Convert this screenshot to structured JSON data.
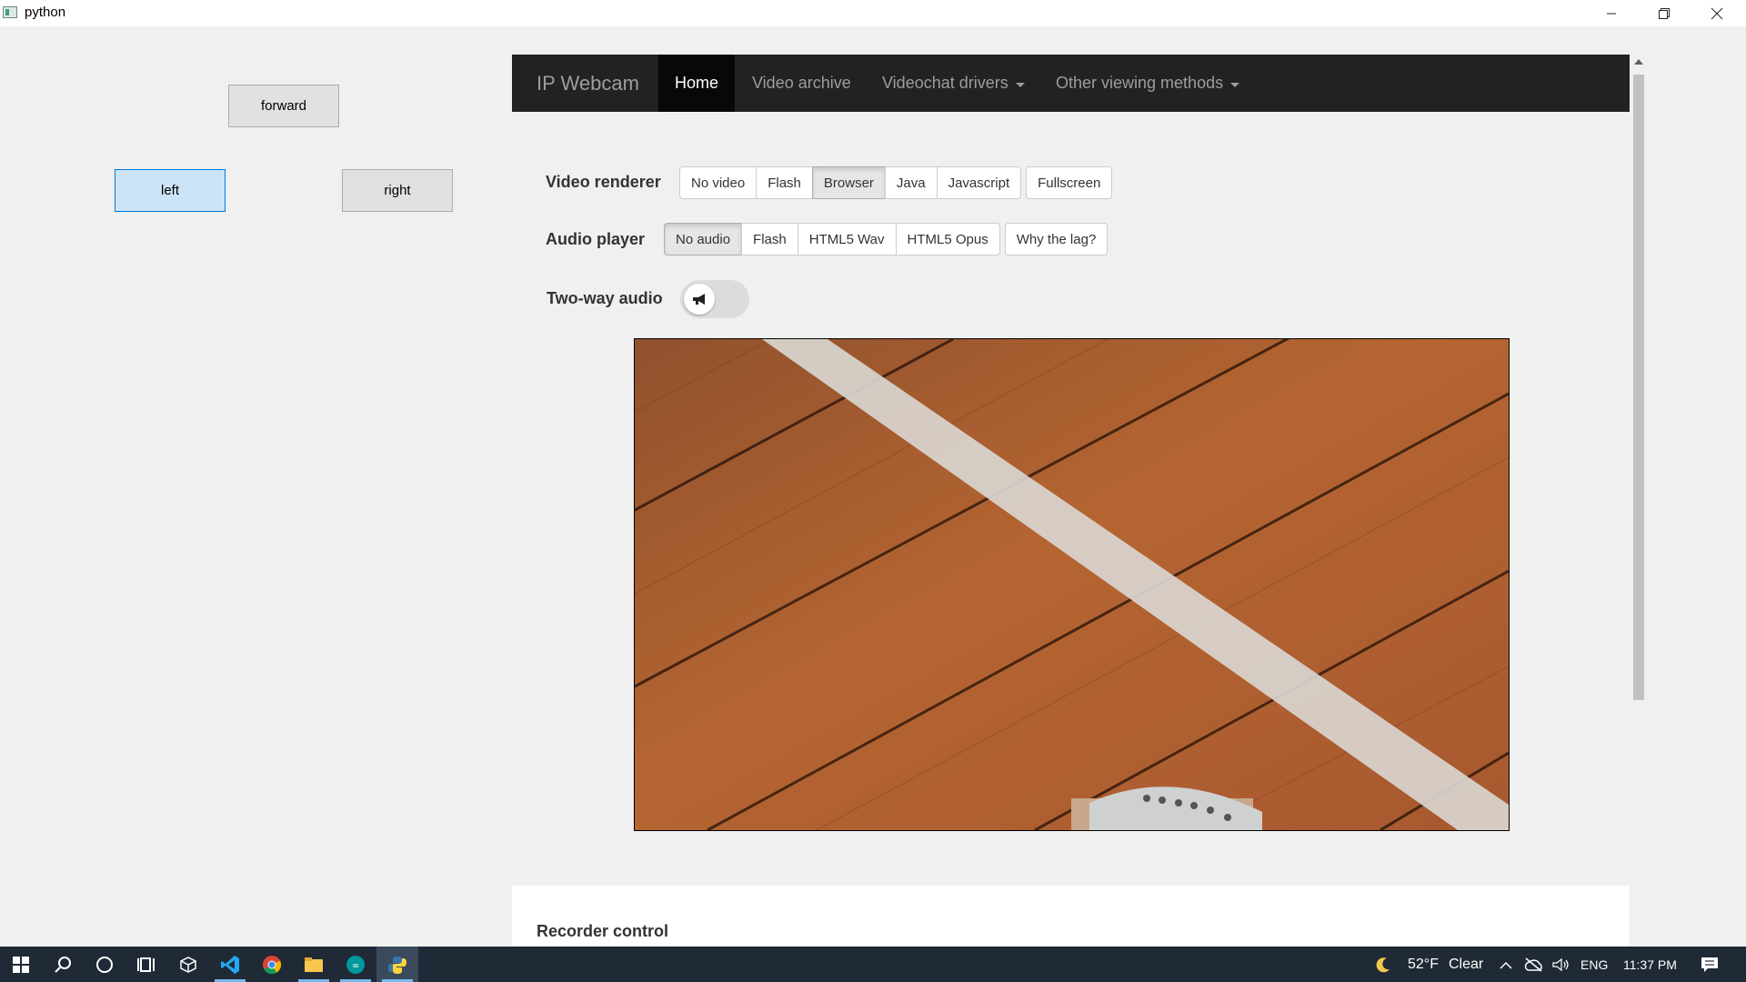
{
  "window": {
    "title": "python",
    "controls": {
      "minimize": "—",
      "restore": "❒",
      "close": "✕"
    }
  },
  "controls_panel": {
    "forward": "forward",
    "left": "left",
    "right": "right"
  },
  "webview": {
    "brand": "IP Webcam",
    "nav": {
      "home": "Home",
      "video_archive": "Video archive",
      "videochat_drivers": "Videochat drivers",
      "other_viewing": "Other viewing methods"
    },
    "video_renderer": {
      "label": "Video renderer",
      "options": [
        "No video",
        "Flash",
        "Browser",
        "Java",
        "Javascript"
      ],
      "selected": "Browser",
      "fullscreen": "Fullscreen"
    },
    "audio_player": {
      "label": "Audio player",
      "options": [
        "No audio",
        "Flash",
        "HTML5 Wav",
        "HTML5 Opus"
      ],
      "selected": "No audio",
      "why_lag": "Why the lag?"
    },
    "two_way_audio": {
      "label": "Two-way audio",
      "icon": "megaphone-icon",
      "enabled": false
    },
    "recorder": {
      "title": "Recorder control"
    },
    "colors": {
      "navbar": "#222222",
      "brand": "#9d9d9d",
      "active_nav": "#080808"
    }
  },
  "taskbar": {
    "weather": {
      "icon": "moon-icon",
      "temp": "52°F",
      "condition": "Clear"
    },
    "language": "ENG",
    "time": "11:37 PM",
    "apps": [
      "start-icon",
      "search-icon",
      "cortana-icon",
      "task-view-icon",
      "3d-icon",
      "vscode-icon",
      "chrome-icon",
      "file-explorer-icon",
      "arduino-icon",
      "python-icon"
    ]
  }
}
